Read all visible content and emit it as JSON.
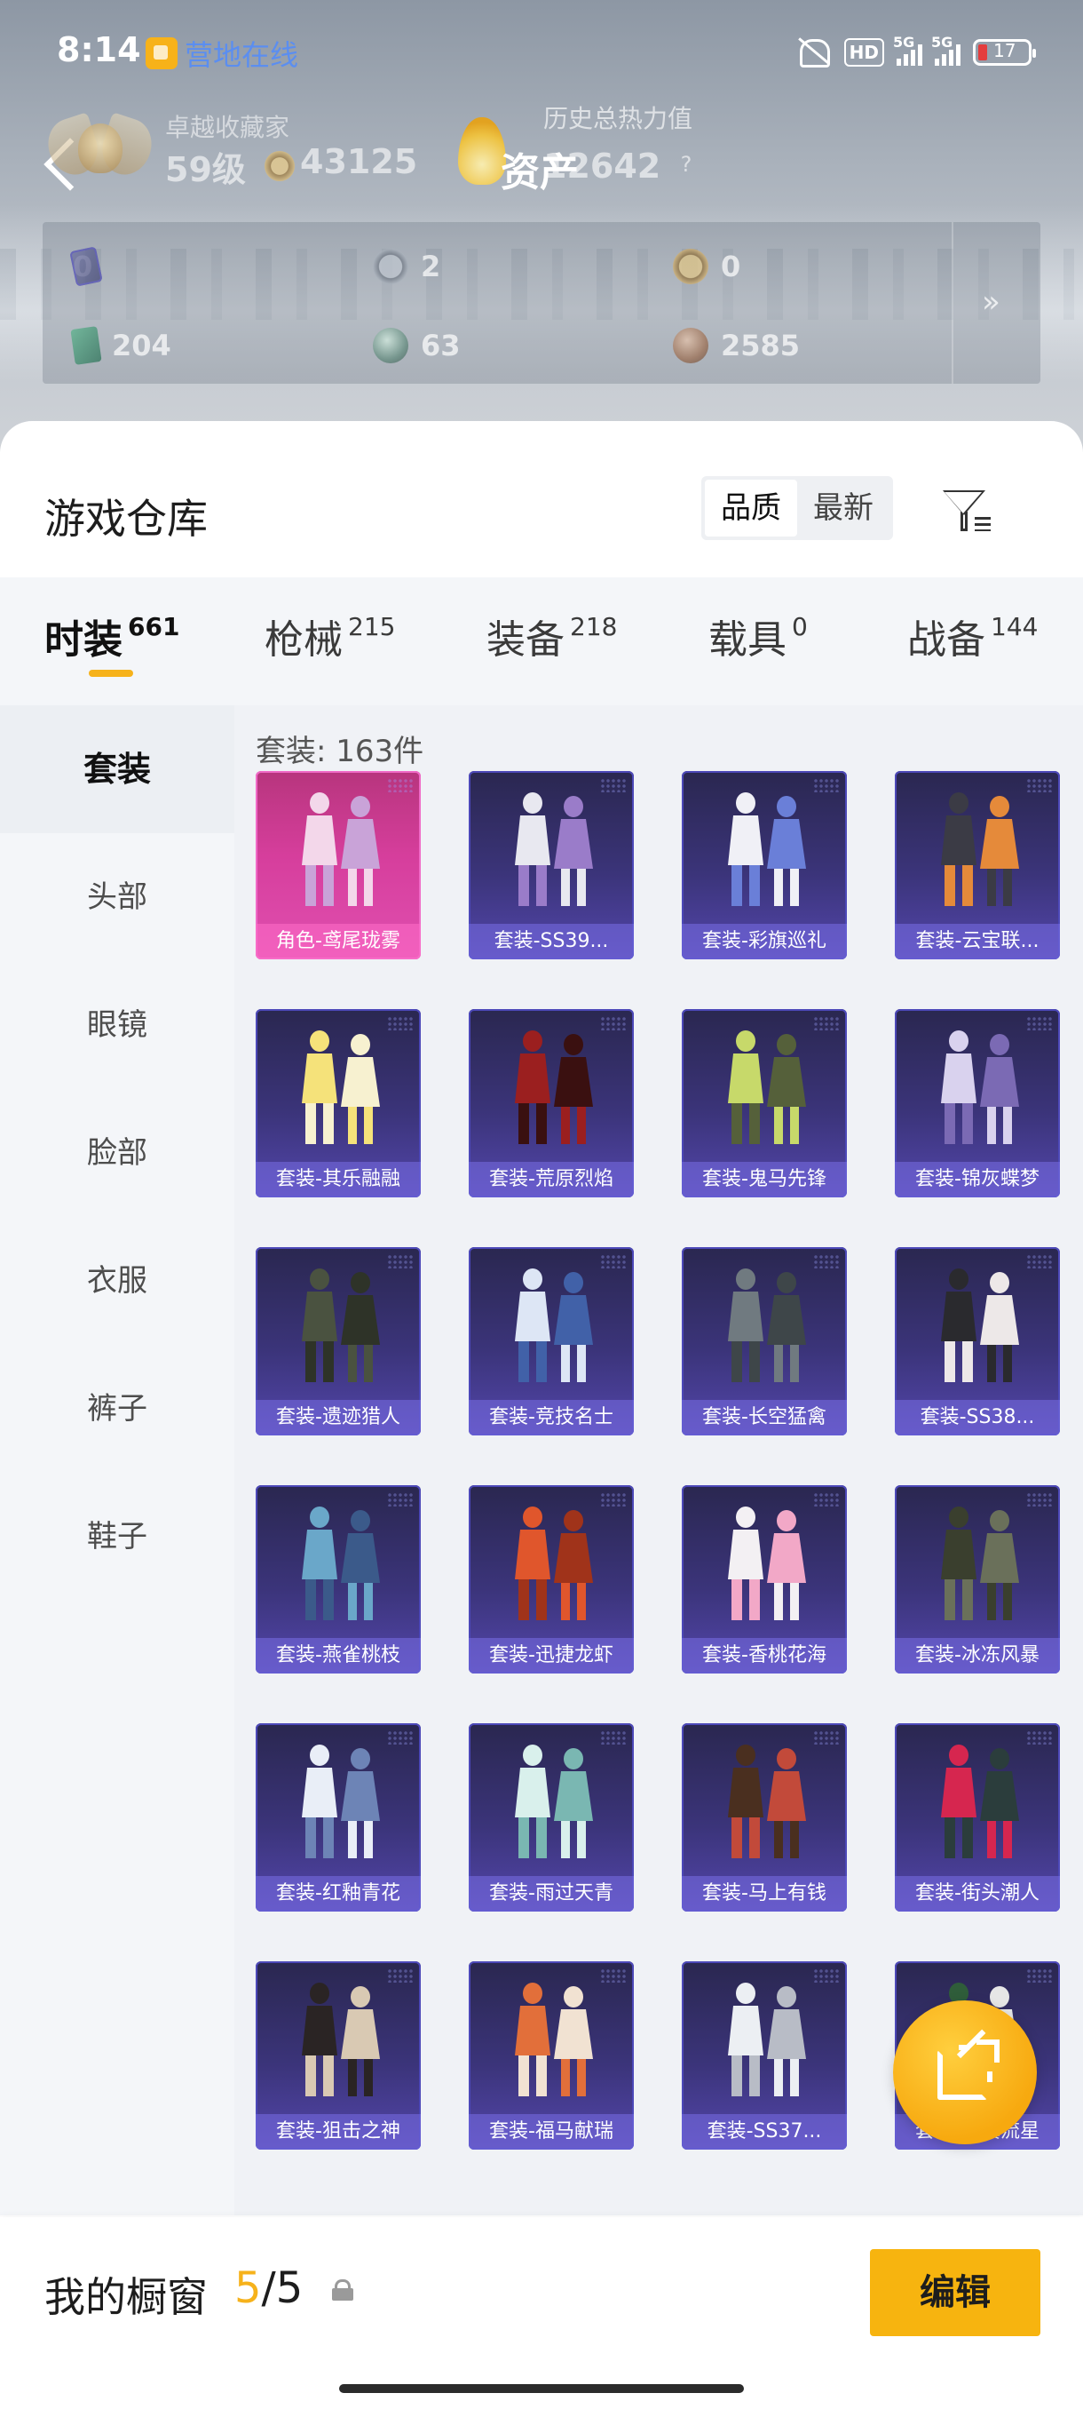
{
  "status_bar": {
    "time": "8:14",
    "app_label": "营地在线",
    "network": "HD",
    "signal_1": "5G",
    "signal_2": "5G",
    "battery": "17"
  },
  "profile": {
    "rank_title": "卓越收藏家",
    "level": "59级",
    "points": "43125",
    "heat_label": "历史总热力值",
    "heat_overlay": "资产",
    "heat_value": "12642",
    "help": "?"
  },
  "currencies": [
    {
      "icon": "card-icon",
      "value": "0"
    },
    {
      "icon": "silver-coin-icon",
      "value": "2"
    },
    {
      "icon": "gold-coin-icon",
      "value": "0"
    },
    {
      "icon": "book-icon",
      "value": "204"
    },
    {
      "icon": "orb-icon",
      "value": "63"
    },
    {
      "icon": "bronze-coin-icon",
      "value": "2585"
    }
  ],
  "more_label": "»",
  "warehouse": {
    "title": "游戏仓库",
    "sort_options": [
      "品质",
      "最新"
    ],
    "sort_active": "品质"
  },
  "categories": [
    {
      "name": "时装",
      "count": "661",
      "active": true
    },
    {
      "name": "枪械",
      "count": "215"
    },
    {
      "name": "装备",
      "count": "218"
    },
    {
      "name": "载具",
      "count": "0"
    },
    {
      "name": "战备",
      "count": "144"
    }
  ],
  "side_nav": [
    "套装",
    "头部",
    "眼镜",
    "脸部",
    "衣服",
    "裤子",
    "鞋子"
  ],
  "suit_count": "套装: 163件",
  "items": [
    {
      "label": "角色-鸢尾珑雾",
      "rarity": "pink"
    },
    {
      "label": "套装-SS39...",
      "rarity": "purple"
    },
    {
      "label": "套装-彩旗巡礼",
      "rarity": "purple"
    },
    {
      "label": "套装-云宝联...",
      "rarity": "purple"
    },
    {
      "label": "套装-其乐融融",
      "rarity": "purple"
    },
    {
      "label": "套装-荒原烈焰",
      "rarity": "purple"
    },
    {
      "label": "套装-鬼马先锋",
      "rarity": "purple"
    },
    {
      "label": "套装-锦灰蝶梦",
      "rarity": "purple"
    },
    {
      "label": "套装-遗迹猎人",
      "rarity": "purple"
    },
    {
      "label": "套装-竞技名士",
      "rarity": "purple"
    },
    {
      "label": "套装-长空猛禽",
      "rarity": "purple"
    },
    {
      "label": "套装-SS38...",
      "rarity": "purple"
    },
    {
      "label": "套装-燕雀桃枝",
      "rarity": "purple"
    },
    {
      "label": "套装-迅捷龙虾",
      "rarity": "purple"
    },
    {
      "label": "套装-香桃花海",
      "rarity": "purple"
    },
    {
      "label": "套装-冰冻风暴",
      "rarity": "purple"
    },
    {
      "label": "套装-红釉青花",
      "rarity": "purple"
    },
    {
      "label": "套装-雨过天青",
      "rarity": "purple"
    },
    {
      "label": "套装-马上有钱",
      "rarity": "purple"
    },
    {
      "label": "套装-街头潮人",
      "rarity": "purple"
    },
    {
      "label": "套装-狙击之神",
      "rarity": "purple"
    },
    {
      "label": "套装-福马献瑞",
      "rarity": "purple"
    },
    {
      "label": "套装-SS37...",
      "rarity": "purple"
    },
    {
      "label": "套装-青翼流星",
      "rarity": "purple"
    }
  ],
  "showcase": {
    "label": "我的橱窗",
    "current": "5",
    "total": "/5",
    "edit": "编辑"
  }
}
